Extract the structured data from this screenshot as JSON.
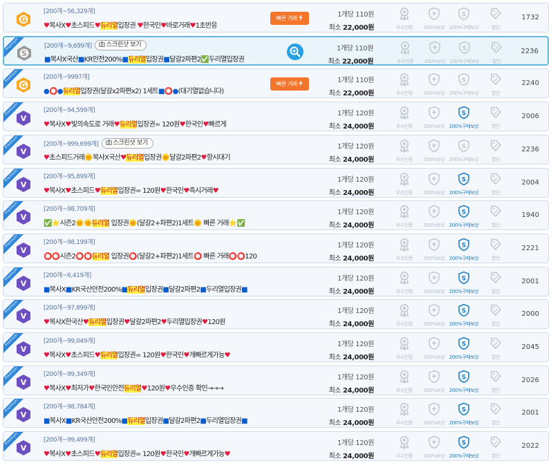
{
  "labels": {
    "screenshot_button": "스크린샷 보기",
    "fast_trade_button": "빠른 거래",
    "premium_ribbon": "Premium",
    "badges": [
      "우수인증",
      "200%보상",
      "200%구매보상",
      "할인"
    ]
  },
  "colors": {
    "row_bg": "#f4f8fd",
    "row_border": "#cfdcee",
    "selected_border": "#64b6dd",
    "meta_text": "#5975a6",
    "ribbon": "#2d86d8",
    "fast_trade": "#f3762c",
    "zoom": "#29a0df",
    "heart": "#e11d3f",
    "highlight": "#ffee44",
    "grade_gold": "#f5a623",
    "grade_silver": "#9a9a9a",
    "grade_v": "#6e4fc2",
    "badge_active": "#1f7fc4",
    "badge_inactive": "#c3c9d1"
  },
  "listings": [
    {
      "meta": "[200개~56,329개]",
      "title": [
        [
          "♥",
          "h"
        ],
        [
          "복사X",
          ""
        ],
        [
          "♥",
          "h"
        ],
        [
          "초스피드",
          ""
        ],
        [
          "♥",
          "h"
        ],
        [
          "듀리열",
          "hl"
        ],
        [
          "입장권 ",
          ""
        ],
        [
          "♥",
          "h"
        ],
        [
          "한국인",
          ""
        ],
        [
          "♥",
          "h"
        ],
        [
          "바로거래",
          ""
        ],
        [
          "♥",
          "h"
        ],
        [
          "1초반응",
          ""
        ]
      ],
      "unit_price": "1개당 110원",
      "min_price_label": "최소",
      "min_price": "22,000원",
      "count": "1732",
      "grade": "gold",
      "premium": false,
      "selected": false,
      "screenshot": false,
      "action": "fast",
      "purchase_reward": false
    },
    {
      "meta": "[200개~9,699개]",
      "title": [
        [
          "■",
          "em"
        ],
        [
          "복사X국산",
          ""
        ],
        [
          "■",
          "em"
        ],
        [
          "KR안전200%",
          ""
        ],
        [
          "■",
          "em"
        ],
        [
          "듀리열",
          "hl"
        ],
        [
          "입장권",
          ""
        ],
        [
          "■",
          "em"
        ],
        [
          "달갈2파편2",
          ""
        ],
        [
          "✅",
          ""
        ],
        [
          "두리열입장권",
          ""
        ]
      ],
      "unit_price": "1개당 110원",
      "min_price_label": "최소",
      "min_price": "22,000원",
      "count": "2236",
      "grade": "silver",
      "premium": true,
      "selected": true,
      "screenshot": true,
      "action": "zoom",
      "purchase_reward": false
    },
    {
      "meta": "[200개~9997개]",
      "title": [
        [
          "●⭕●",
          "em"
        ],
        [
          "듀리열",
          "hl"
        ],
        [
          "입장권(달갈x2파편x2) 1세트",
          ""
        ],
        [
          "■⭕●",
          "em"
        ],
        [
          "(대기열없습니다)",
          ""
        ]
      ],
      "unit_price": "1개당 110원",
      "min_price_label": "최소",
      "min_price": "22,000원",
      "count": "2240",
      "grade": "gold",
      "premium": true,
      "selected": false,
      "screenshot": false,
      "action": "fast",
      "purchase_reward": false
    },
    {
      "meta": "[200개~94,599개]",
      "title": [
        [
          "♥",
          "h"
        ],
        [
          "복사X",
          ""
        ],
        [
          "♥",
          "h"
        ],
        [
          "빛의속도로 거래",
          ""
        ],
        [
          "♥",
          "h"
        ],
        [
          "듀리열",
          "hl"
        ],
        [
          "입장권= 120원",
          ""
        ],
        [
          "♥",
          "h"
        ],
        [
          "한국인",
          ""
        ],
        [
          "♥",
          "h"
        ],
        [
          "빠르게",
          ""
        ]
      ],
      "unit_price": "1개당 120원",
      "min_price_label": "최소",
      "min_price": "24,000원",
      "count": "2006",
      "grade": "v",
      "premium": true,
      "selected": false,
      "screenshot": false,
      "action": "",
      "purchase_reward": true
    },
    {
      "meta": "[200개~999,699개]",
      "title": [
        [
          "♥",
          "h"
        ],
        [
          "초스피드거래",
          ""
        ],
        [
          "🌞",
          ""
        ],
        [
          "복사X국산",
          ""
        ],
        [
          "♥",
          "h"
        ],
        [
          "듀리열",
          "hl"
        ],
        [
          "입장권",
          ""
        ],
        [
          "🌞",
          ""
        ],
        [
          "달갈2파편2",
          ""
        ],
        [
          "♥",
          "h"
        ],
        [
          "항시대기",
          ""
        ]
      ],
      "unit_price": "1개당 120원",
      "min_price_label": "최소",
      "min_price": "24,000원",
      "count": "2236",
      "grade": "v",
      "premium": true,
      "selected": false,
      "screenshot": true,
      "action": "",
      "purchase_reward": false
    },
    {
      "meta": "[200개~95,899개]",
      "title": [
        [
          "♥",
          "h"
        ],
        [
          "복사X",
          ""
        ],
        [
          "♥",
          "h"
        ],
        [
          "초스피드",
          ""
        ],
        [
          "♥",
          "h"
        ],
        [
          "듀리열",
          "hl"
        ],
        [
          "입장권= 120원",
          ""
        ],
        [
          "♥",
          "h"
        ],
        [
          "한국인",
          ""
        ],
        [
          "♥",
          "h"
        ],
        [
          "즉시거래",
          ""
        ],
        [
          "♥",
          "h"
        ]
      ],
      "unit_price": "1개당 120원",
      "min_price_label": "최소",
      "min_price": "24,000원",
      "count": "2004",
      "grade": "v",
      "premium": true,
      "selected": false,
      "screenshot": false,
      "action": "",
      "purchase_reward": true
    },
    {
      "meta": "[200개~98,709개]",
      "title": [
        [
          "✅⭐",
          ""
        ],
        [
          "시즌2",
          ""
        ],
        [
          "🌞🌞",
          ""
        ],
        [
          "듀리열",
          "hl"
        ],
        [
          " 입장권",
          ""
        ],
        [
          "🌞",
          ""
        ],
        [
          "(달갈2+파편2)1세트",
          ""
        ],
        [
          "🌞",
          ""
        ],
        [
          " 빠른 거래",
          ""
        ],
        [
          "⭐✅",
          ""
        ]
      ],
      "unit_price": "1개당 120원",
      "min_price_label": "최소",
      "min_price": "24,000원",
      "count": "1940",
      "grade": "v",
      "premium": true,
      "selected": false,
      "screenshot": false,
      "action": "",
      "purchase_reward": true
    },
    {
      "meta": "[200개~98,199개]",
      "title": [
        [
          "⭕⭕",
          "h"
        ],
        [
          "시즌2",
          ""
        ],
        [
          "⭕⭕",
          "h"
        ],
        [
          "듀리열",
          "hl"
        ],
        [
          " 입장권",
          ""
        ],
        [
          "⭕",
          "h"
        ],
        [
          "(달갈2+파편2)1세트",
          ""
        ],
        [
          "⭕",
          "h"
        ],
        [
          " 빠른 거래",
          ""
        ],
        [
          "⭕⭕",
          "h"
        ],
        [
          "120",
          ""
        ]
      ],
      "unit_price": "1개당 120원",
      "min_price_label": "최소",
      "min_price": "24,000원",
      "count": "2221",
      "grade": "v",
      "premium": true,
      "selected": false,
      "screenshot": false,
      "action": "",
      "purchase_reward": true
    },
    {
      "meta": "[200개~6,419개]",
      "title": [
        [
          "■",
          "em"
        ],
        [
          "복사X",
          ""
        ],
        [
          "■",
          "em"
        ],
        [
          "KR국산안전200%",
          ""
        ],
        [
          "■",
          "em"
        ],
        [
          "듀리열",
          "hl"
        ],
        [
          "입장권",
          ""
        ],
        [
          "■",
          "em"
        ],
        [
          "달갈2파편2",
          ""
        ],
        [
          "■",
          "em"
        ],
        [
          "두리열입장권",
          ""
        ],
        [
          "■",
          "em"
        ]
      ],
      "unit_price": "1개당 120원",
      "min_price_label": "최소",
      "min_price": "24,000원",
      "count": "2001",
      "grade": "v",
      "premium": true,
      "selected": false,
      "screenshot": false,
      "action": "",
      "purchase_reward": true
    },
    {
      "meta": "[200개~97,899개]",
      "title": [
        [
          "♥",
          "h"
        ],
        [
          "복사X한국산",
          ""
        ],
        [
          "♥",
          "h"
        ],
        [
          "듀리열",
          "hl"
        ],
        [
          "입장권",
          ""
        ],
        [
          "♥",
          "h"
        ],
        [
          "달갈2파편2",
          ""
        ],
        [
          "♥",
          "h"
        ],
        [
          "두리열입장권",
          ""
        ],
        [
          "♥",
          "h"
        ],
        [
          "120원",
          ""
        ]
      ],
      "unit_price": "1개당 120원",
      "min_price_label": "최소",
      "min_price": "24,000원",
      "count": "2000",
      "grade": "v",
      "premium": true,
      "selected": false,
      "screenshot": false,
      "action": "",
      "purchase_reward": true
    },
    {
      "meta": "[200개~99,049개]",
      "title": [
        [
          "♥",
          "h"
        ],
        [
          "복사X",
          ""
        ],
        [
          "♥",
          "h"
        ],
        [
          "초스피드",
          ""
        ],
        [
          "♥",
          "h"
        ],
        [
          "듀리열",
          "hl"
        ],
        [
          "입장권= 120원",
          ""
        ],
        [
          "♥",
          "h"
        ],
        [
          "한국인",
          ""
        ],
        [
          "♥",
          "h"
        ],
        [
          "개빠르게가능",
          ""
        ],
        [
          "♥",
          "h"
        ]
      ],
      "unit_price": "1개당 120원",
      "min_price_label": "최소",
      "min_price": "24,000원",
      "count": "2045",
      "grade": "v",
      "premium": true,
      "selected": false,
      "screenshot": false,
      "action": "",
      "purchase_reward": true
    },
    {
      "meta": "[200개~99,349개]",
      "title": [
        [
          "♥",
          "h"
        ],
        [
          "복사X",
          ""
        ],
        [
          "♥",
          "h"
        ],
        [
          "최저가",
          ""
        ],
        [
          "♥",
          "h"
        ],
        [
          "한국인안전",
          ""
        ],
        [
          "듀리열",
          "hl"
        ],
        [
          "♥",
          "h"
        ],
        [
          "120원",
          ""
        ],
        [
          "♥",
          "h"
        ],
        [
          "우수인증 확인→→→",
          ""
        ]
      ],
      "unit_price": "1개당 120원",
      "min_price_label": "최소",
      "min_price": "24,000원",
      "count": "2026",
      "grade": "v",
      "premium": true,
      "selected": false,
      "screenshot": false,
      "action": "",
      "purchase_reward": true
    },
    {
      "meta": "[200개~98,784개]",
      "title": [
        [
          "■",
          "em"
        ],
        [
          "복사X",
          ""
        ],
        [
          "■",
          "em"
        ],
        [
          "KR국산안전200%",
          ""
        ],
        [
          "■",
          "em"
        ],
        [
          "듀리열",
          "hl"
        ],
        [
          "입장권",
          ""
        ],
        [
          "■",
          "em"
        ],
        [
          "달갈2파편2",
          ""
        ],
        [
          "■",
          "em"
        ],
        [
          "두리열입장권",
          ""
        ],
        [
          "■",
          "em"
        ]
      ],
      "unit_price": "1개당 120원",
      "min_price_label": "최소",
      "min_price": "24,000원",
      "count": "2001",
      "grade": "v",
      "premium": true,
      "selected": false,
      "screenshot": false,
      "action": "",
      "purchase_reward": true
    },
    {
      "meta": "[200개~99,499개]",
      "title": [
        [
          "♥",
          "h"
        ],
        [
          "복사X",
          ""
        ],
        [
          "♥",
          "h"
        ],
        [
          "초스피드",
          ""
        ],
        [
          "♥",
          "h"
        ],
        [
          "듀리열",
          "hl"
        ],
        [
          "입장권= 120원",
          ""
        ],
        [
          "♥",
          "h"
        ],
        [
          "한국인",
          ""
        ],
        [
          "♥",
          "h"
        ],
        [
          "개빠르게가능",
          ""
        ],
        [
          "♥",
          "h"
        ]
      ],
      "unit_price": "1개당 120원",
      "min_price_label": "최소",
      "min_price": "24,000원",
      "count": "2022",
      "grade": "v",
      "premium": true,
      "selected": false,
      "screenshot": false,
      "action": "",
      "purchase_reward": true
    }
  ]
}
